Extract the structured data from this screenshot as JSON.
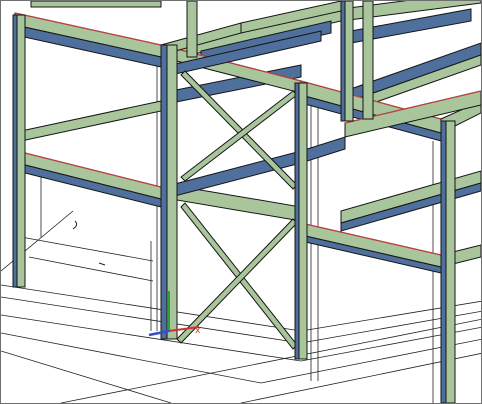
{
  "viewport": {
    "title": "",
    "visual_style": "",
    "view_name": ""
  },
  "colors": {
    "background": "#ffffff",
    "steel_fill": "#a9c59b",
    "steel_dark": "#4f6f9c",
    "steel_edge": "#151515",
    "flange_highlight": "#c04040",
    "grid_line": "#222222",
    "ucs_x": "#d03030",
    "ucs_y": "#30a030",
    "ucs_z": "#3050d0"
  },
  "icons": {
    "ucs": "ucs-icon"
  }
}
